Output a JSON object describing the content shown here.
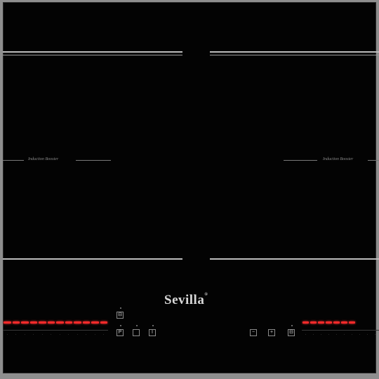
{
  "brand": {
    "name": "Sevilla",
    "reg_mark": "®"
  },
  "zones": [
    {
      "label": "Induction Booster"
    },
    {
      "label": "Induction Booster"
    }
  ],
  "controls": {
    "left_slider": {
      "level": 1.0
    },
    "right_slider": {
      "level": 0.65
    },
    "keys": {
      "lock": "⊟",
      "pause": "P",
      "blank": "",
      "power": "I",
      "minus": "−",
      "plus": "+",
      "timer": "⊟"
    }
  },
  "colors": {
    "glass": "#030303",
    "frame": "#8e8e8e",
    "indicator": "#ff2a2a"
  }
}
